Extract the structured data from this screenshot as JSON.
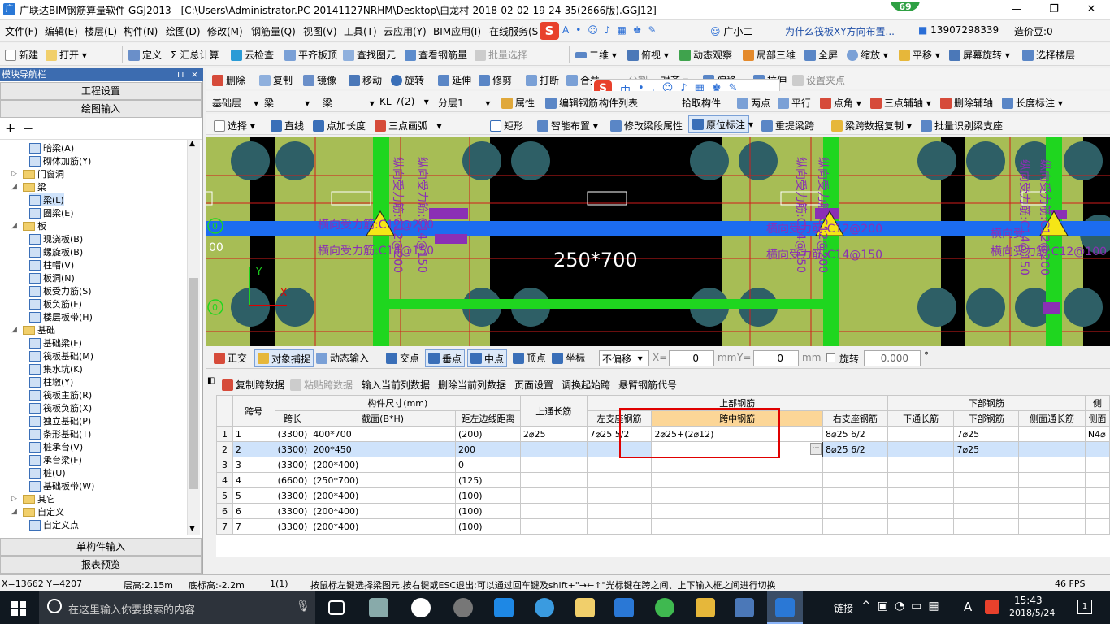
{
  "window": {
    "title": "广联达BIM钢筋算量软件 GGJ2013 - [C:\\Users\\Administrator.PC-20141127NRHM\\Desktop\\白龙村-2018-02-02-19-24-35(2666版).GGJ12]",
    "badge": "69",
    "min": "—",
    "max": "❐",
    "close": "✕"
  },
  "menu": [
    "文件(F)",
    "编辑(E)",
    "楼层(L)",
    "构件(N)",
    "绘图(D)",
    "修改(M)",
    "钢筋量(Q)",
    "视图(V)",
    "工具(T)",
    "云应用(Y)",
    "BIM应用(I)",
    "在线服务(S"
  ],
  "menu_right": {
    "assistant": "广小二",
    "question": "为什么筏板XY方向布置...",
    "phone": "13907298339",
    "bean": "造价豆:0"
  },
  "toolbar1": [
    "新建",
    "打开",
    "定义",
    "Σ 汇总计算",
    "云检查",
    "平齐板顶",
    "查找图元",
    "查看钢筋量",
    "批量选择",
    "二维",
    "俯视",
    "动态观察",
    "局部三维",
    "全屏",
    "缩放",
    "平移",
    "屏幕旋转",
    "选择楼层"
  ],
  "toolbar2": [
    "删除",
    "复制",
    "镜像",
    "移动",
    "旋转",
    "延伸",
    "修剪",
    "打断",
    "合并",
    "分割",
    "对齐",
    "偏移",
    "拉伸",
    "设置夹点"
  ],
  "toolbar3": {
    "floor": "基础层",
    "type1": "梁",
    "type2": "梁",
    "name": "KL-7(2)",
    "layer": "分层1",
    "items": [
      "属性",
      "编辑钢筋",
      "构件列表",
      "拾取构件",
      "两点",
      "平行",
      "点角",
      "三点辅轴",
      "删除辅轴",
      "长度标注"
    ]
  },
  "toolbar4": [
    "选择",
    "直线",
    "点加长度",
    "三点画弧",
    "矩形",
    "智能布置",
    "修改梁段属性",
    "原位标注",
    "重提梁跨",
    "梁跨数据复制",
    "批量识别梁支座"
  ],
  "ime": {
    "logo": "S",
    "mode": "中"
  },
  "panel": {
    "title": "模块导航栏",
    "pin": "⊓",
    "close": "×",
    "btn1": "工程设置",
    "btn2": "绘图输入",
    "btn3": "单构件输入",
    "btn4": "报表预览",
    "plus": "+",
    "minus": "−"
  },
  "tree": [
    {
      "label": "暗梁(A)",
      "level": 2,
      "kind": "item"
    },
    {
      "label": "砌体加筋(Y)",
      "level": 2,
      "kind": "item"
    },
    {
      "label": "门窗洞",
      "level": 1,
      "kind": "folder",
      "exp": "▷"
    },
    {
      "label": "梁",
      "level": 1,
      "kind": "folder",
      "exp": "◢"
    },
    {
      "label": "梁(L)",
      "level": 2,
      "kind": "item",
      "selected": true
    },
    {
      "label": "圈梁(E)",
      "level": 2,
      "kind": "item"
    },
    {
      "label": "板",
      "level": 1,
      "kind": "folder",
      "exp": "◢"
    },
    {
      "label": "现浇板(B)",
      "level": 2,
      "kind": "item"
    },
    {
      "label": "螺旋板(B)",
      "level": 2,
      "kind": "item"
    },
    {
      "label": "柱帽(V)",
      "level": 2,
      "kind": "item"
    },
    {
      "label": "板洞(N)",
      "level": 2,
      "kind": "item"
    },
    {
      "label": "板受力筋(S)",
      "level": 2,
      "kind": "item"
    },
    {
      "label": "板负筋(F)",
      "level": 2,
      "kind": "item"
    },
    {
      "label": "楼层板带(H)",
      "level": 2,
      "kind": "item"
    },
    {
      "label": "基础",
      "level": 1,
      "kind": "folder",
      "exp": "◢"
    },
    {
      "label": "基础梁(F)",
      "level": 2,
      "kind": "item"
    },
    {
      "label": "筏板基础(M)",
      "level": 2,
      "kind": "item"
    },
    {
      "label": "集水坑(K)",
      "level": 2,
      "kind": "item"
    },
    {
      "label": "柱墩(Y)",
      "level": 2,
      "kind": "item"
    },
    {
      "label": "筏板主筋(R)",
      "level": 2,
      "kind": "item"
    },
    {
      "label": "筏板负筋(X)",
      "level": 2,
      "kind": "item"
    },
    {
      "label": "独立基础(P)",
      "level": 2,
      "kind": "item"
    },
    {
      "label": "条形基础(T)",
      "level": 2,
      "kind": "item"
    },
    {
      "label": "桩承台(V)",
      "level": 2,
      "kind": "item"
    },
    {
      "label": "承台梁(F)",
      "level": 2,
      "kind": "item"
    },
    {
      "label": "桩(U)",
      "level": 2,
      "kind": "item"
    },
    {
      "label": "基础板带(W)",
      "level": 2,
      "kind": "item"
    },
    {
      "label": "其它",
      "level": 1,
      "kind": "folder",
      "exp": "▷"
    },
    {
      "label": "自定义",
      "level": 1,
      "kind": "folder",
      "exp": "◢"
    },
    {
      "label": "自定义点",
      "level": 2,
      "kind": "item"
    }
  ],
  "canvas": {
    "section_label": "250*700",
    "labels_horiz": [
      "横向受力筋:C12@200",
      "横向受力筋:C14@150"
    ],
    "labels_vert": [
      "纵向受力筋:C14@150",
      "纵向受力筋:C12@200"
    ],
    "frag_horiz": [
      "横向受力筋:C12@200",
      "横向受力筋:C14@150",
      "横向受",
      "C12@20",
      "横向受力筋:C12@100"
    ],
    "axis_num": "0",
    "axis_num2": "00",
    "axis_x": "X",
    "axis_y": "Y"
  },
  "snapbar": {
    "items": [
      "正交",
      "对象捕捉",
      "动态输入",
      "交点",
      "垂点",
      "中点",
      "顶点",
      "坐标"
    ],
    "offset_mode": "不偏移",
    "x_label": "X=",
    "x_val": "0",
    "y_label": "Y=",
    "y_val": "0",
    "unit": "mm",
    "rotate_label": "旋转",
    "rotate_val": "0.000",
    "deg": "°"
  },
  "grid_toolbar": [
    "复制跨数据",
    "粘贴跨数据",
    "输入当前列数据",
    "删除当前列数据",
    "页面设置",
    "调换起始跨",
    "悬臂钢筋代号"
  ],
  "grid": {
    "group_headers": {
      "span_no": "跨号",
      "dims": "构件尺寸(mm)",
      "top_long": "上通长筋",
      "top_rebar": "上部钢筋",
      "bottom_rebar": "下部钢筋",
      "side": "侧"
    },
    "sub_headers": [
      "跨长",
      "截面(B*H)",
      "距左边线距离",
      "左支座钢筋",
      "跨中钢筋",
      "右支座钢筋",
      "下通长筋",
      "下部钢筋",
      "侧面通长筋",
      "侧面"
    ],
    "rows": [
      [
        "1",
        "1",
        "(3300)",
        "400*700",
        "(200)",
        "2⌀25",
        "7⌀25 5/2",
        "2⌀25+(2⌀12)",
        "8⌀25 6/2",
        "",
        "7⌀25",
        "",
        "N4⌀"
      ],
      [
        "2",
        "2",
        "(3300)",
        "200*450",
        "200",
        "",
        "",
        "",
        "8⌀25 6/2",
        "",
        "7⌀25",
        "",
        ""
      ],
      [
        "3",
        "3",
        "(3300)",
        "(200*400)",
        "0",
        "",
        "",
        "",
        "",
        "",
        "",
        "",
        ""
      ],
      [
        "4",
        "4",
        "(6600)",
        "(250*700)",
        "(125)",
        "",
        "",
        "",
        "",
        "",
        "",
        "",
        ""
      ],
      [
        "5",
        "5",
        "(3300)",
        "(200*400)",
        "(100)",
        "",
        "",
        "",
        "",
        "",
        "",
        "",
        ""
      ],
      [
        "6",
        "6",
        "(3300)",
        "(200*400)",
        "(100)",
        "",
        "",
        "",
        "",
        "",
        "",
        "",
        ""
      ],
      [
        "7",
        "7",
        "(3300)",
        "(200*400)",
        "(100)",
        "",
        "",
        "",
        "",
        "",
        "",
        "",
        ""
      ]
    ],
    "ellipsis": "⋯"
  },
  "status": {
    "coords": "X=13662 Y=4207",
    "floor_h": "层高:2.15m",
    "bottom_h": "底标高:-2.2m",
    "count": "1(1)",
    "hint": "按鼠标左键选择梁图元,按右键或ESC退出;可以通过回车键及shift+\"→←↑\"光标键在跨之间、上下输入框之间进行切换",
    "fps": "46 FPS"
  },
  "taskbar": {
    "search": "在这里输入你要搜索的内容",
    "link": "链接",
    "time": "15:43",
    "date": "2018/5/24",
    "lang": "A",
    "notify": "1"
  },
  "colors": {
    "accent": "#3c6cb0",
    "selected_header": "#fcd697",
    "selected_row": "#cfe3fb",
    "red_box": "#e00000",
    "green": "#1fd61f",
    "blue": "#1c6cf0",
    "olive": "#a7bd55",
    "purple": "#8b2fb5"
  }
}
